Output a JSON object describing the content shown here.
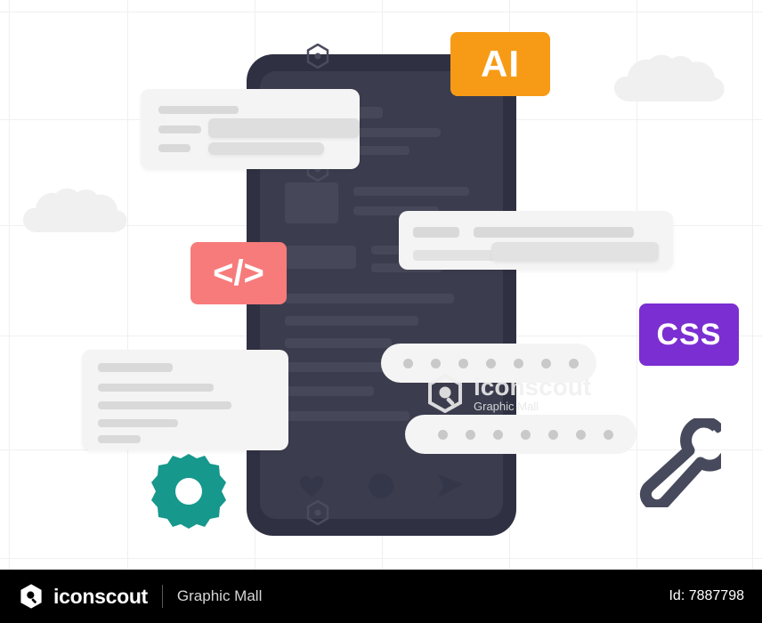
{
  "illustration": {
    "badges": [
      {
        "id": "ai",
        "label": "AI",
        "color": "#f79b16"
      },
      {
        "id": "code",
        "label": "</>",
        "color": "#f77b7b"
      },
      {
        "id": "css",
        "label": "CSS",
        "color": "#7b2ed1"
      }
    ],
    "watermark": {
      "title": "iconscout",
      "subtitle": "Graphic Mall"
    },
    "colors": {
      "phone_frame": "#2f3142",
      "phone_screen": "#3b3d4e",
      "panel": "#f4f4f4",
      "panel_line": "#d9d9d9",
      "gear": "#16988c",
      "wrench": "#474a5c",
      "grid": "#f0f0f0",
      "cloud": "#f0f0f0"
    }
  },
  "footer": {
    "logo_text": "iconscout",
    "brand": "Graphic Mall",
    "id_label": "Id: 7887798"
  }
}
